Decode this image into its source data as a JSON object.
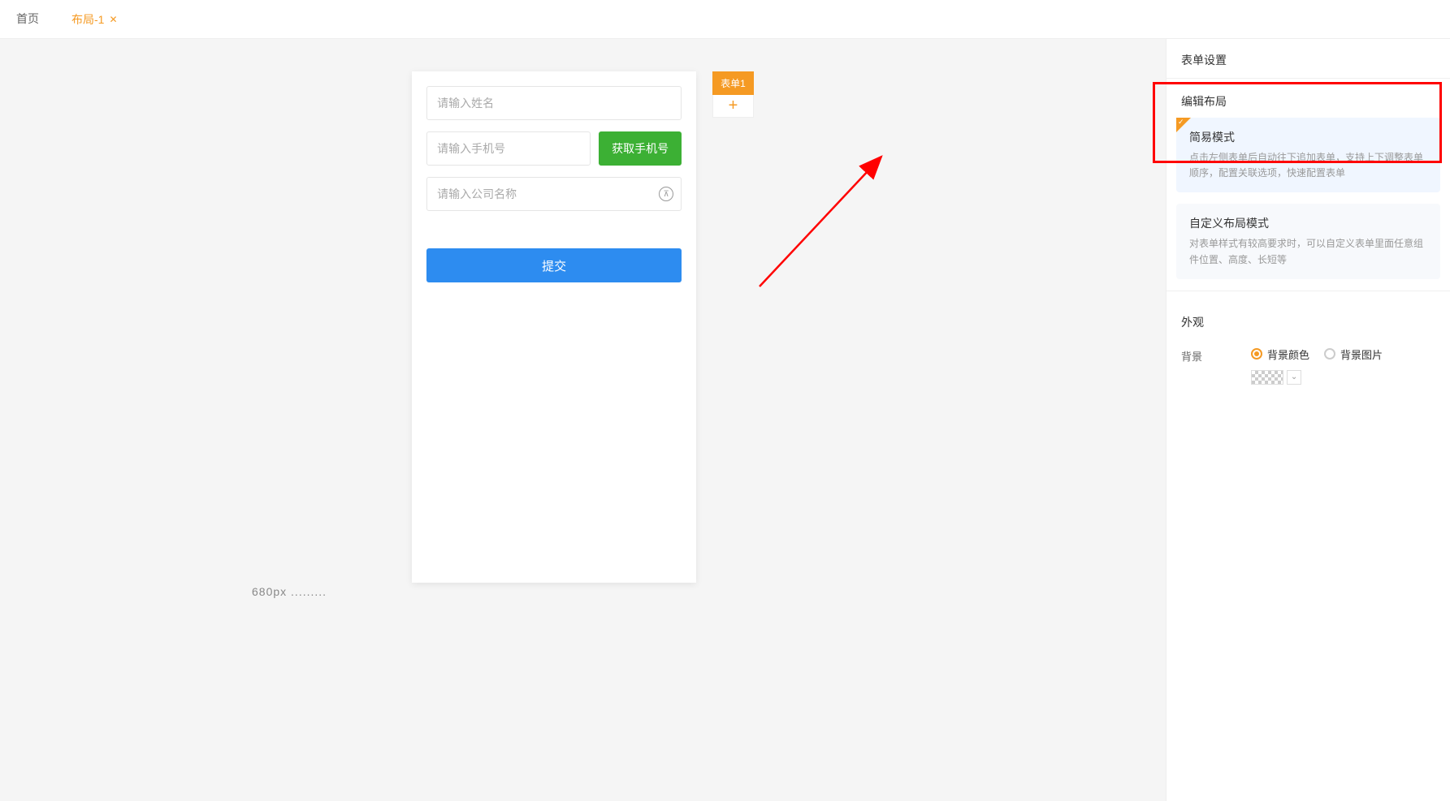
{
  "tabs": {
    "home": "首页",
    "layout": "布局-1"
  },
  "form": {
    "name_placeholder": "请输入姓名",
    "phone_placeholder": "请输入手机号",
    "get_phone_btn": "获取手机号",
    "company_placeholder": "请输入公司名称",
    "submit_btn": "提交"
  },
  "side": {
    "form_tag": "表单1",
    "add": "+"
  },
  "canvas": {
    "dimension": "680px ........."
  },
  "panel": {
    "header": "表单设置",
    "edit_layout_title": "编辑布局",
    "modes": [
      {
        "title": "简易模式",
        "desc": "点击左侧表单后自动往下追加表单，支持上下调整表单顺序，配置关联选项，快速配置表单"
      },
      {
        "title": "自定义布局模式",
        "desc": "对表单样式有较高要求时，可以自定义表单里面任意组件位置、高度、长短等"
      }
    ],
    "appearance_title": "外观",
    "background_label": "背景",
    "radio_bgcolor": "背景颜色",
    "radio_bgimage": "背景图片"
  }
}
